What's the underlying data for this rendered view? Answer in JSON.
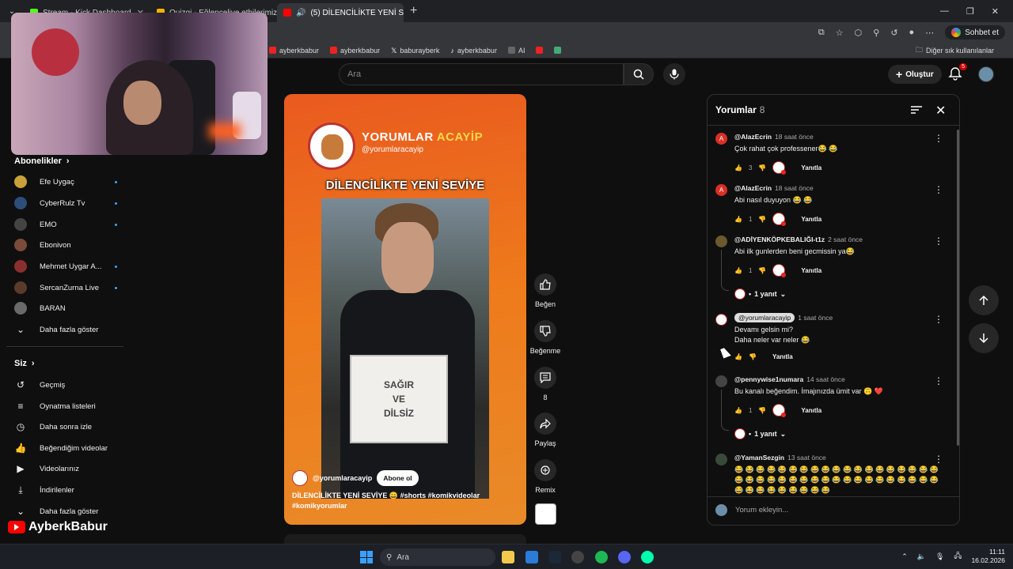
{
  "browser": {
    "tabs": [
      {
        "label": "Stream - Kick Dashboard",
        "active": false,
        "color": "#53fc18"
      },
      {
        "label": "Quizgi - Eğlenceliye ethilerimiz...",
        "active": false,
        "color": "#f4b400"
      },
      {
        "label": "(5) DİLENCİLİKTE YENİ SEVİYE",
        "active": true,
        "color": "#ff0000"
      }
    ],
    "chat_button": "Sohbet et",
    "bookmarks": [
      {
        "label": "ayberkbabur",
        "icon": "youtube-icon"
      },
      {
        "label": "ayberkbabur",
        "icon": "youtube-icon"
      },
      {
        "label": "baburayberk",
        "icon": "x-icon"
      },
      {
        "label": "ayberkbabur",
        "icon": "tiktok-icon"
      },
      {
        "label": "AI",
        "icon": "ai-icon"
      }
    ],
    "bookmarks_other": "Diğer sık kullanılanlar"
  },
  "header": {
    "search_placeholder": "Ara",
    "create_label": "Oluştur",
    "notification_count": "5"
  },
  "sidebar": {
    "subs_heading": "Abonelikler",
    "subscriptions": [
      {
        "name": "Efe Uygaç",
        "color": "#c9a23a"
      },
      {
        "name": "CyberRulz Tv",
        "color": "#2e4e7a"
      },
      {
        "name": "EMO",
        "color": "#444"
      },
      {
        "name": "Ebonivon",
        "color": "#7a4b3a"
      },
      {
        "name": "Mehmet Uygar A...",
        "color": "#8a2f2f"
      },
      {
        "name": "SercanZurna Live",
        "color": "#5a3a2a"
      },
      {
        "name": "BARAN",
        "color": "#6a6a6a"
      }
    ],
    "show_more": "Daha fazla göster",
    "you_heading": "Siz",
    "you_items": [
      {
        "label": "Geçmiş",
        "icon": "history-icon",
        "glyph": "↺"
      },
      {
        "label": "Oynatma listeleri",
        "icon": "playlist-icon",
        "glyph": "≡"
      },
      {
        "label": "Daha sonra izle",
        "icon": "clock-icon",
        "glyph": "◷"
      },
      {
        "label": "Beğendiğim videolar",
        "icon": "like-icon",
        "glyph": "👍"
      },
      {
        "label": "Videolarınız",
        "icon": "video-icon",
        "glyph": "▶"
      },
      {
        "label": "İndirilenler",
        "icon": "download-icon",
        "glyph": "⤓"
      },
      {
        "label": "Daha fazla göster",
        "icon": "chevron-down-icon",
        "glyph": "⌄"
      }
    ],
    "brand": "AyberkBabur"
  },
  "short": {
    "channel_name_1": "YORUMLAR",
    "channel_name_2": "ACAYİP",
    "channel_handle": "@yorumlaracayip",
    "video_title": "DİLENCİLİKTE YENİ SEVİYE",
    "sign_line1": "SAĞIR",
    "sign_line2": "VE",
    "sign_line3": "DİLSİZ",
    "caption_channel": "@yorumlaracayip",
    "subscribe_label": "Abone ol",
    "description": "DİLENCİLİKTE YENİ SEVİYE 😄",
    "tags": "#shorts #komikvideolar #komikyorumlar"
  },
  "actions": {
    "like": "Beğen",
    "dislike": "Beğenme",
    "comments": "8",
    "share": "Paylaş",
    "remix": "Remix"
  },
  "comments_panel": {
    "title": "Yorumlar",
    "count": "8",
    "input_placeholder": "Yorum ekleyin...",
    "reply_label": "Yanıtla",
    "comments": [
      {
        "author": "@AlazEcrin",
        "time": "18 saat önce",
        "text": "Çok rahat çok professener😂 😂",
        "likes": "3",
        "avatar": "#d93025",
        "initial": "A"
      },
      {
        "author": "@AlazEcrin",
        "time": "18 saat önce",
        "text": "Abi nasıl duyuyon 😂 😂",
        "likes": "1",
        "avatar": "#d93025",
        "initial": "A"
      },
      {
        "author": "@ADİYENKÖPKEBALIĞI-t1z",
        "time": "2 saat önce",
        "text": "Abi ilk gunlerden beni gecmissin ya😂",
        "likes": "1",
        "avatar": "#6b5a2e",
        "initial": "",
        "replies": "1 yanıt"
      },
      {
        "author": "@yorumlaracayip",
        "time": "1 saat önce",
        "text": "Devamı gelsin mi?",
        "text2": "Daha neler var neler 😂",
        "likes": "",
        "avatar": "#ffffff",
        "initial": ""
      },
      {
        "author": "@pennywise1numara",
        "time": "14 saat önce",
        "text": "Bu kanalı beğendim. İmajınızda ümit var 🙃 ❤️",
        "likes": "1",
        "avatar": "#444444",
        "initial": "",
        "replies": "1 yanıt"
      },
      {
        "author": "@YamanSezgin",
        "time": "13 saat önce",
        "text": "😂 😂 😂 😂 😂 😂 😂 😂 😂 😂 😂 😂 😂 😂 😂 😂 😂 😂 😂 😂 😂 😂 😂 😂 😂 😂 😂 😂 😂 😂 😂 😂 😂 😂 😂 😂 😂 😂 😂 😂 😂 😂 😂 😂 😂 😂 😂",
        "avatar": "#3a4a3a",
        "initial": ""
      }
    ]
  },
  "taskbar": {
    "search_label": "Ara",
    "time": "11:11",
    "date": "16.02.2026"
  }
}
